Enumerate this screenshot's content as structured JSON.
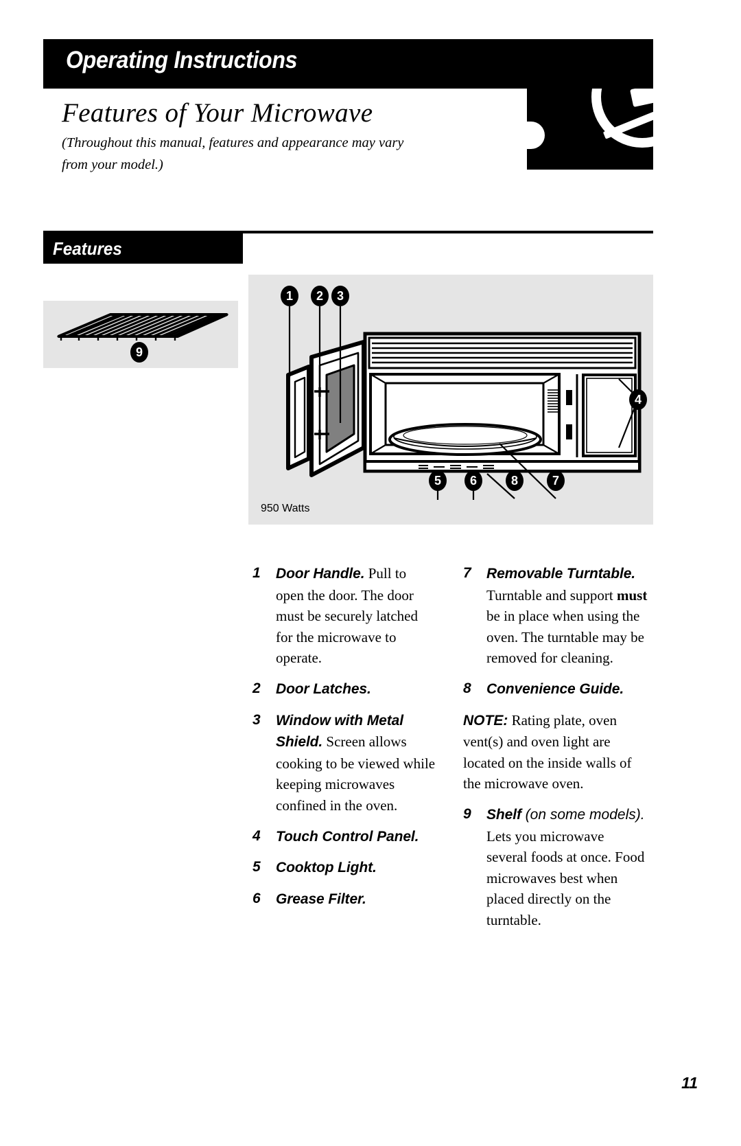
{
  "header": {
    "banner_title": "Operating Instructions",
    "heading": "Features of Your Microwave",
    "subheading": "(Throughout this manual, features and appearance may vary from your model.)",
    "dial_icon": "microwave-dial-icon"
  },
  "section": {
    "tab_label": "Features"
  },
  "illustration": {
    "watts_label": "950 Watts",
    "oven_callouts": [
      "1",
      "2",
      "3",
      "4",
      "5",
      "6",
      "7",
      "8"
    ],
    "shelf_callout": "9"
  },
  "features": {
    "left_column": [
      {
        "number": "1",
        "title": "Door Handle.",
        "body": " Pull to open the door. The door must be securely latched for the microwave to operate."
      },
      {
        "number": "2",
        "title": "Door Latches.",
        "body": ""
      },
      {
        "number": "3",
        "title": "Window with Metal Shield.",
        "body": " Screen allows cooking to be viewed while keeping microwaves confined in the oven."
      },
      {
        "number": "4",
        "title": "Touch Control Panel.",
        "body": ""
      },
      {
        "number": "5",
        "title": "Cooktop Light.",
        "body": ""
      },
      {
        "number": "6",
        "title": "Grease Filter.",
        "body": ""
      }
    ],
    "right_column": [
      {
        "number": "7",
        "title": "Removable Turntable.",
        "body_pre": "Turntable and support ",
        "body_bold": "must",
        "body_post": " be in place when using the oven. The turntable may be removed for cleaning."
      },
      {
        "number": "8",
        "title": "Convenience Guide.",
        "body": ""
      }
    ],
    "note": {
      "label": "NOTE:",
      "text": " Rating plate, oven vent(s) and oven light are located on the inside walls of the microwave oven."
    },
    "shelf_item": {
      "number": "9",
      "title": "Shelf",
      "title_light": " (on some models).",
      "body": " Lets you microwave several foods at once. Food microwaves best when placed directly on the turntable."
    }
  },
  "footer": {
    "page_number": "11"
  },
  "colors": {
    "ink": "#000000",
    "paper": "#ffffff",
    "panel": "#e5e5e5",
    "window_glass": "#808080"
  }
}
